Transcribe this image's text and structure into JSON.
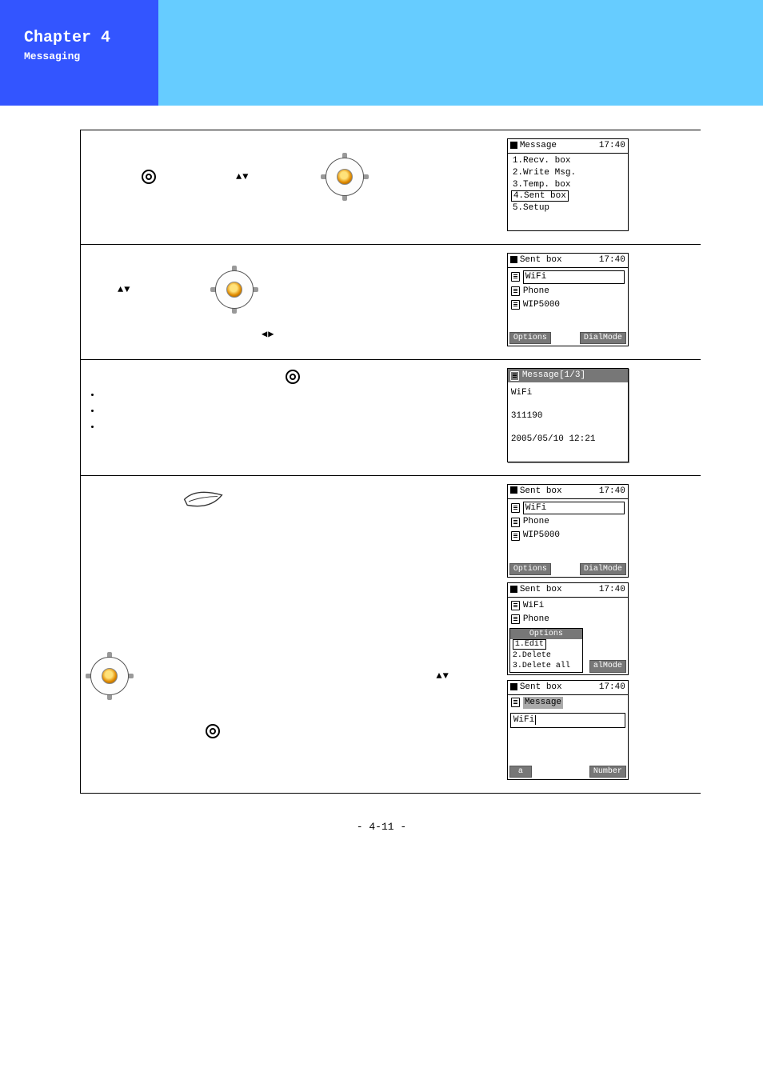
{
  "header": {
    "chapter": "Chapter 4",
    "subtitle": "Messaging"
  },
  "footer": {
    "page": "- 4-11 -"
  },
  "glyphs": {
    "updown": "▲▼",
    "leftright": "◀▶"
  },
  "screens": {
    "message_menu": {
      "title": "Message",
      "time": "17:40",
      "items": [
        "1.Recv. box",
        "2.Write Msg.",
        "3.Temp. box",
        "4.Sent box",
        "5.Setup"
      ],
      "selected_index": 3
    },
    "sent_box_a": {
      "title": "Sent box",
      "time": "17:40",
      "rows": [
        "WiFi",
        "Phone",
        "WIP5000"
      ],
      "selected_index": 0,
      "soft_left": "Options",
      "soft_right": "DialMode"
    },
    "msg_detail": {
      "header": "Message[1/3]",
      "line1": "WiFi",
      "line2": "311190",
      "line3": "2005/05/10 12:21"
    },
    "sent_box_b": {
      "title": "Sent box",
      "time": "17:40",
      "rows": [
        "WiFi",
        "Phone",
        "WIP5000"
      ],
      "selected_index": 0,
      "soft_left": "Options",
      "soft_right": "DialMode"
    },
    "sent_box_options": {
      "title": "Sent box",
      "time": "17:40",
      "rows": [
        "WiFi",
        "Phone"
      ],
      "popup_title": "Options",
      "popup_items": [
        "1.Edit",
        "2.Delete",
        "3.Delete all"
      ],
      "popup_selected": 0,
      "behind_text": "alMode"
    },
    "edit_msg": {
      "title": "Sent box",
      "time": "17:40",
      "field_label": "Message",
      "field_value": "WiFi",
      "soft_left": "a",
      "soft_right": "Number"
    }
  }
}
